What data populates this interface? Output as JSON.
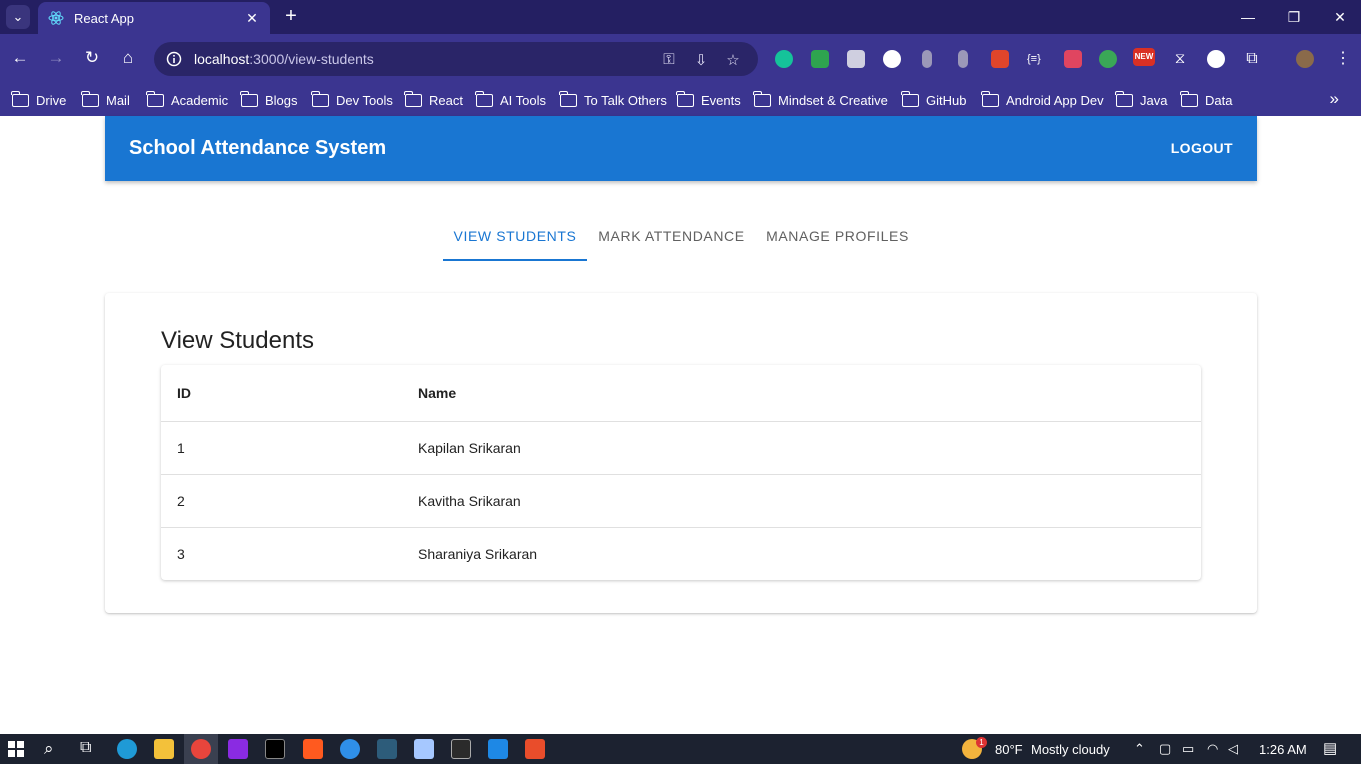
{
  "browser": {
    "tab_title": "React App",
    "url_host": "localhost",
    "url_path": ":3000/view-students",
    "bookmarks": [
      "Drive",
      "Mail",
      "Academic",
      "Blogs",
      "Dev Tools",
      "React",
      "AI Tools",
      "To Talk Others",
      "Events",
      "Mindset & Creative",
      "GitHub",
      "Android App Dev",
      "Java",
      "Data"
    ],
    "extension_badge": "NEW"
  },
  "app": {
    "title": "School Attendance System",
    "logout_label": "LOGOUT",
    "tabs": [
      {
        "label": "VIEW STUDENTS",
        "active": true
      },
      {
        "label": "MARK ATTENDANCE",
        "active": false
      },
      {
        "label": "MANAGE PROFILES",
        "active": false
      }
    ],
    "page_heading": "View Students",
    "table": {
      "columns": [
        "ID",
        "Name"
      ],
      "rows": [
        [
          "1",
          "Kapilan Srikaran"
        ],
        [
          "2",
          "Kavitha Srikaran"
        ],
        [
          "3",
          "Sharaniya Srikaran"
        ]
      ]
    },
    "colors": {
      "primary": "#1976d2"
    }
  },
  "taskbar": {
    "weather_temp": "80°F",
    "weather_desc": "Mostly cloudy",
    "weather_badge": "1",
    "time": "1:26 AM"
  }
}
